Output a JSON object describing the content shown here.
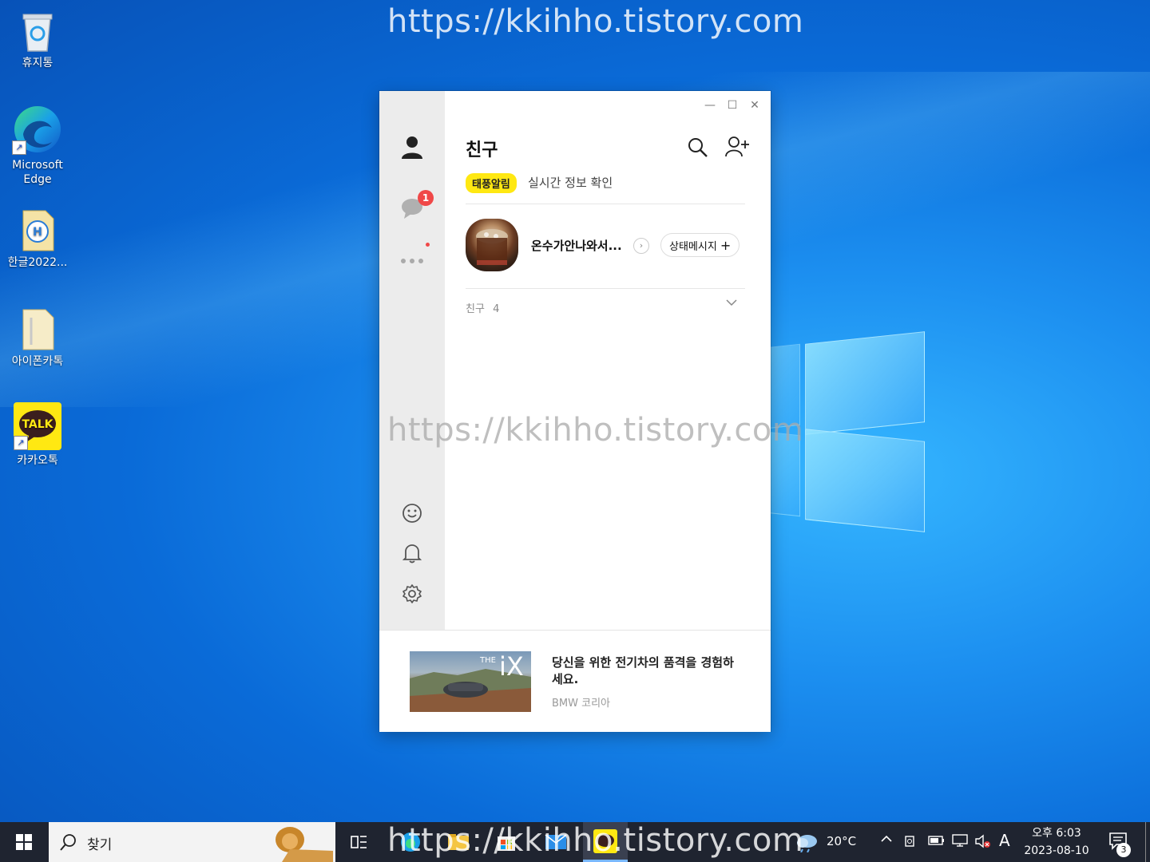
{
  "watermark": "https://kkihho.tistory.com",
  "desktop": {
    "icons": [
      {
        "label": "휴지통"
      },
      {
        "label": "Microsoft Edge"
      },
      {
        "label": "한글2022..."
      },
      {
        "label": "아이폰카톡"
      },
      {
        "label": "카카오톡"
      }
    ]
  },
  "kakao": {
    "sidebar": {
      "chat_badge": "1"
    },
    "header": {
      "title": "친구"
    },
    "notice": {
      "tag": "태풍알림",
      "text": "실시간 정보 확인"
    },
    "profile": {
      "name": "온수가안나와서...",
      "status_button": "상태메시지"
    },
    "friends_section": {
      "label": "친구",
      "count": "4"
    },
    "ad": {
      "image_text": "iX",
      "image_small": "THE",
      "title": "당신을 위한 전기차의 품격을 경험하세요.",
      "source": "BMW 코리아"
    }
  },
  "taskbar": {
    "search_placeholder": "찾기",
    "weather": "20°C",
    "ime": "A",
    "clock_time": "오후 6:03",
    "clock_date": "2023-08-10",
    "notification_count": "3"
  }
}
